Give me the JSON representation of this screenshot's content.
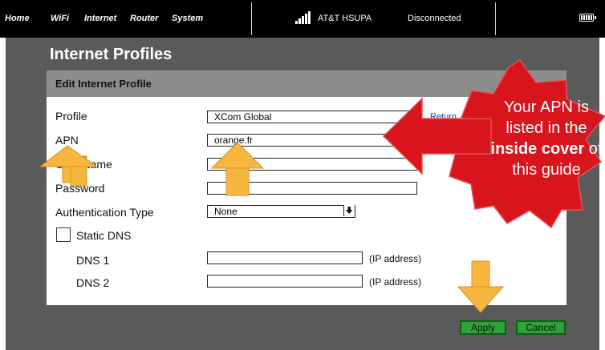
{
  "nav": {
    "items": [
      "Home",
      "WiFi",
      "Internet",
      "Router",
      "System"
    ]
  },
  "status_bar": {
    "network_name": "AT&T HSUPA",
    "connection_status": "Disconnected",
    "icons": [
      "signal-icon",
      "battery-icon"
    ]
  },
  "page": {
    "title": "Internet Profiles",
    "section_title": "Edit Internet Profile"
  },
  "form": {
    "profile": {
      "label": "Profile",
      "value": "XCom Global",
      "link": "Return"
    },
    "apn": {
      "label": "APN",
      "value": "orange.fr"
    },
    "username": {
      "label": "User Name",
      "value": ""
    },
    "password": {
      "label": "Password",
      "value": ""
    },
    "auth_type": {
      "label": "Authentication Type",
      "value": "None",
      "icon": "arrow-down-icon"
    },
    "static_dns": {
      "label": "Static DNS",
      "checked": false
    },
    "dns1": {
      "label": "DNS 1",
      "value": "",
      "hint": "(IP address)"
    },
    "dns2": {
      "label": "DNS 2",
      "value": "",
      "hint": "(IP address)"
    }
  },
  "buttons": {
    "apply": "Apply",
    "cancel": "Cancel"
  },
  "callout": {
    "line1": "Your APN is",
    "line2": "listed in the",
    "line3_bold": "inside cover",
    "line3_rest": " of",
    "line4": "this guide"
  },
  "colors": {
    "topbar": "#000000",
    "panel": "#5a5a5a",
    "section_header": "#8d8d8d",
    "button_fill": "#2fa33a",
    "button_border": "#0f5e17",
    "callout_red": "#d8141c",
    "arrow_orange": "#f7b63d",
    "link": "#1a3ea6"
  }
}
